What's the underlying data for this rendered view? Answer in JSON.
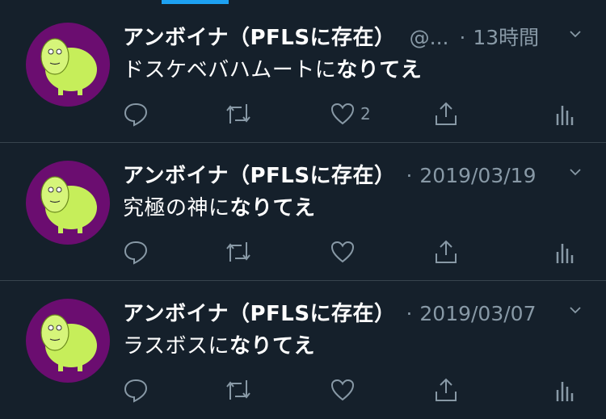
{
  "tweets": [
    {
      "display_name": "アンボイナ（PFLSに存在）",
      "handle": "@...",
      "time": "13時間",
      "text_plain": "ドスケベバハムートに",
      "text_bold": "なりてえ",
      "like_count": "2"
    },
    {
      "display_name": "アンボイナ（PFLSに存在）",
      "handle": "",
      "time": "2019/03/19",
      "text_plain": "究極の神に",
      "text_bold": "なりてえ",
      "like_count": ""
    },
    {
      "display_name": "アンボイナ（PFLSに存在）",
      "handle": "",
      "time": "2019/03/07",
      "text_plain": "ラスボスに",
      "text_bold": "なりてえ",
      "like_count": ""
    }
  ],
  "colors": {
    "background": "#15202b",
    "accent": "#1da1f2",
    "muted": "#8899a6",
    "divider": "#38444d",
    "avatar_bg": "#6b0d70",
    "creature": "#c6ee5a"
  },
  "icons": [
    "reply-icon",
    "retweet-icon",
    "like-icon",
    "share-icon",
    "analytics-icon",
    "chevron-down-icon"
  ]
}
